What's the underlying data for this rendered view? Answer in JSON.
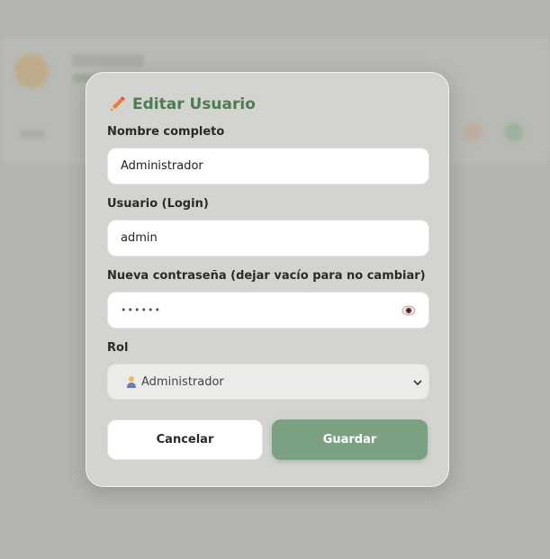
{
  "modal": {
    "title": "Editar Usuario",
    "title_icon": "pencil-icon",
    "accent_color": "#4f7b52"
  },
  "form": {
    "full_name": {
      "label": "Nombre completo",
      "value": "Administrador"
    },
    "username": {
      "label": "Usuario (Login)",
      "value": "admin"
    },
    "password": {
      "label": "Nueva contraseña (dejar vacío para no cambiar)",
      "value": "••••••",
      "toggle_icon": "eye-icon"
    },
    "role": {
      "label": "Rol",
      "selected": "Administrador",
      "icon": "person-icon"
    }
  },
  "buttons": {
    "cancel": "Cancelar",
    "save": "Guardar",
    "save_color": "#7ba182"
  }
}
